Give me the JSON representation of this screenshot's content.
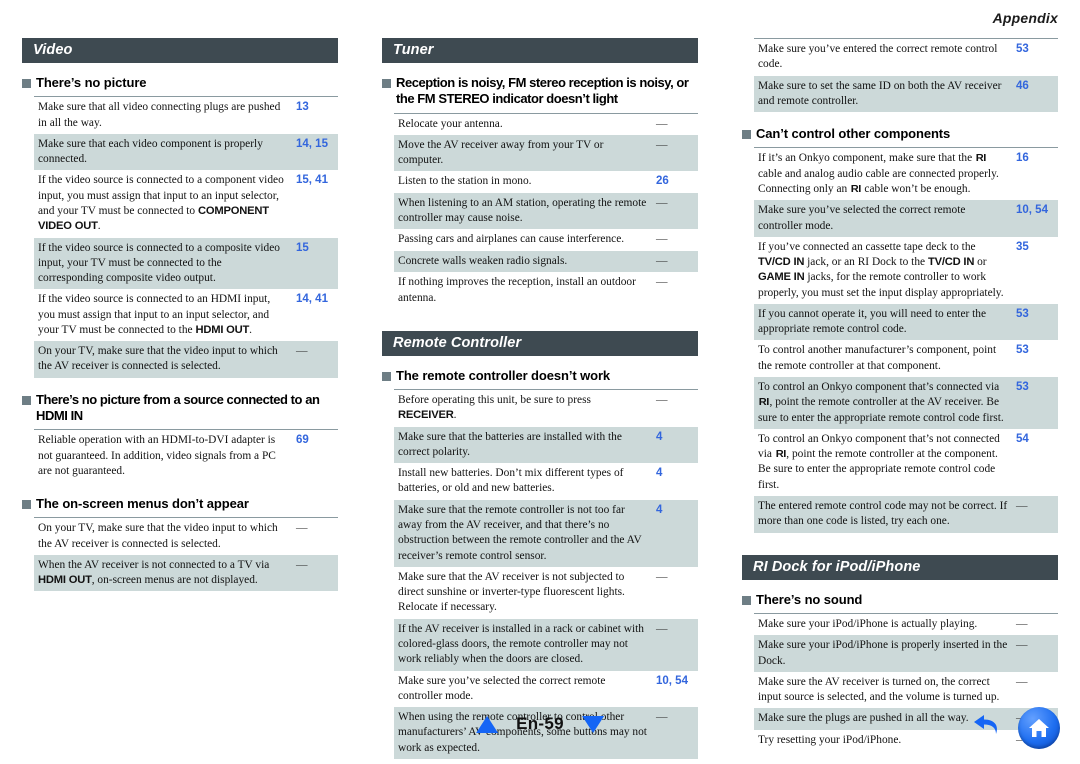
{
  "header": {
    "title": "Appendix"
  },
  "footer": {
    "page_label": "En-59",
    "up_icon": "triangle-up-icon",
    "down_icon": "triangle-down-icon",
    "back_icon": "back-arrow-icon",
    "home_icon": "home-icon",
    "accent_color": "#1565f5"
  },
  "colors": {
    "band_bg": "#3e4a51",
    "row_shade": "#ccd9d9",
    "ref_blue": "#3366dd",
    "bullet": "#6e7e85"
  },
  "columns": [
    {
      "sections": [
        {
          "band": "Video",
          "groups": [
            {
              "subhead": "There’s no picture",
              "rows": [
                {
                  "text": "Make sure that all video connecting plugs are pushed in all the way.",
                  "ref": "13"
                },
                {
                  "text": "Make sure that each video component is properly connected.",
                  "ref": "14, 15"
                },
                {
                  "text": "If the video source is connected to a component video input, you must assign that input to an input selector, and your TV must be connected to <b>COMPONENT VIDEO OUT</b>.",
                  "ref": "15, 41"
                },
                {
                  "text": "If the video source is connected to a composite video input, your TV must be connected to the corresponding composite video output.",
                  "ref": "15"
                },
                {
                  "text": "If the video source is connected to an HDMI input, you must assign that input to an input selector, and your TV must be connected to the <b>HDMI OUT</b>.",
                  "ref": "14, 41"
                },
                {
                  "text": "On your TV, make sure that the video input to which the AV receiver is connected is selected.",
                  "ref": "—"
                }
              ]
            },
            {
              "subhead": "There’s no picture from a source connected to an HDMI IN",
              "rows": [
                {
                  "text": "Reliable operation with an HDMI-to-DVI adapter is not guaranteed. In addition, video signals from a PC are not guaranteed.",
                  "ref": "69"
                }
              ]
            },
            {
              "subhead": "The on-screen menus don’t appear",
              "rows": [
                {
                  "text": "On your TV, make sure that the video input to which the AV receiver is connected is selected.",
                  "ref": "—"
                },
                {
                  "text": "When the AV receiver is not connected to a TV via <b>HDMI OUT</b>, on-screen menus are not displayed.",
                  "ref": "—"
                }
              ]
            }
          ]
        }
      ]
    },
    {
      "sections": [
        {
          "band": "Tuner",
          "groups": [
            {
              "subhead": "Reception is noisy, FM stereo reception is noisy, or the FM STEREO indicator doesn’t light",
              "rows": [
                {
                  "text": "Relocate your antenna.",
                  "ref": "—"
                },
                {
                  "text": "Move the AV receiver away from your TV or computer.",
                  "ref": "—"
                },
                {
                  "text": "Listen to the station in mono.",
                  "ref": "26"
                },
                {
                  "text": "When listening to an AM station, operating the remote controller may cause noise.",
                  "ref": "—"
                },
                {
                  "text": "Passing cars and airplanes can cause interference.",
                  "ref": "—"
                },
                {
                  "text": "Concrete walls weaken radio signals.",
                  "ref": "—"
                },
                {
                  "text": "If nothing improves the reception, install an outdoor antenna.",
                  "ref": "—"
                }
              ]
            }
          ]
        },
        {
          "band": "Remote Controller",
          "groups": [
            {
              "subhead": "The remote controller doesn’t work",
              "rows": [
                {
                  "text": "Before operating this unit, be sure to press <b>RECEIVER</b>.",
                  "ref": "—"
                },
                {
                  "text": "Make sure that the batteries are installed with the correct polarity.",
                  "ref": "4"
                },
                {
                  "text": "Install new batteries. Don’t mix different types of batteries, or old and new batteries.",
                  "ref": "4"
                },
                {
                  "text": "Make sure that the remote controller is not too far away from the AV receiver, and that there’s no obstruction between the remote controller and the AV receiver’s remote control sensor.",
                  "ref": "4"
                },
                {
                  "text": "Make sure that the AV receiver is not subjected to direct sunshine or inverter-type fluorescent lights. Relocate if necessary.",
                  "ref": "—"
                },
                {
                  "text": "If the AV receiver is installed in a rack or cabinet with colored-glass doors, the remote controller may not work reliably when the doors are closed.",
                  "ref": "—"
                },
                {
                  "text": "Make sure you’ve selected the correct remote controller mode.",
                  "ref": "10, 54"
                },
                {
                  "text": "When using the remote controller to control other manufacturers’ AV components, some buttons may not work as expected.",
                  "ref": "—"
                }
              ]
            }
          ]
        }
      ]
    },
    {
      "sections": [
        {
          "band": "",
          "groups": [
            {
              "subhead": "",
              "rows": [
                {
                  "text": "Make sure you’ve entered the correct remote control code.",
                  "ref": "53"
                },
                {
                  "text": "Make sure to set the same ID on both the AV receiver and remote controller.",
                  "ref": "46"
                }
              ]
            },
            {
              "subhead": "Can’t control other components",
              "rows": [
                {
                  "text": "If it’s an Onkyo component, make sure that the <span class=\"ri\">RI</span> cable and analog audio cable are connected properly. Connecting only an <span class=\"ri\">RI</span> cable won’t be enough.",
                  "ref": "16"
                },
                {
                  "text": "Make sure you’ve selected the correct remote controller mode.",
                  "ref": "10, 54"
                },
                {
                  "text": "If you’ve connected an cassette tape deck to the <b>TV/CD IN</b> jack, or an RI Dock to the <b>TV/CD IN</b> or <b>GAME IN</b> jacks, for the remote controller to work properly, you must set the input display appropriately.",
                  "ref": "35"
                },
                {
                  "text": "If you cannot operate it, you will need to enter the appropriate remote control code.",
                  "ref": "53"
                },
                {
                  "text": "To control another manufacturer’s component, point the remote controller at that component.",
                  "ref": "53"
                },
                {
                  "text": "To control an Onkyo component that’s connected via <span class=\"ri\">RI</span>, point the remote controller at the AV receiver. Be sure to enter the appropriate remote control code first.",
                  "ref": "53"
                },
                {
                  "text": "To control an Onkyo component that’s not connected via <span class=\"ri\">RI</span>, point the remote controller at the component. Be sure to enter the appropriate remote control code first.",
                  "ref": "54"
                },
                {
                  "text": "The entered remote control code may not be correct. If more than one code is listed, try each one.",
                  "ref": "—"
                }
              ]
            }
          ]
        },
        {
          "band": "RI Dock for iPod/iPhone",
          "groups": [
            {
              "subhead": "There’s no sound",
              "rows": [
                {
                  "text": "Make sure your iPod/iPhone is actually playing.",
                  "ref": "—"
                },
                {
                  "text": "Make sure your iPod/iPhone is properly inserted in the Dock.",
                  "ref": "—"
                },
                {
                  "text": "Make sure the AV receiver is turned on, the correct input source is selected, and the volume is turned up.",
                  "ref": "—"
                },
                {
                  "text": "Make sure the plugs are pushed in all the way.",
                  "ref": "—"
                },
                {
                  "text": "Try resetting your iPod/iPhone.",
                  "ref": "—"
                }
              ]
            }
          ]
        }
      ]
    }
  ]
}
